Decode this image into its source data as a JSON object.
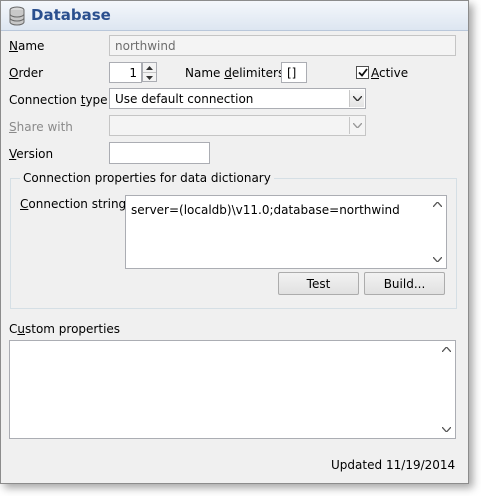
{
  "window": {
    "title": "Database",
    "title_icon": "database-icon"
  },
  "fields": {
    "name_label": "Name",
    "name_value": "northwind",
    "order_label": "Order",
    "order_value": "1",
    "name_delimiters_label": "Name delimiters",
    "name_delimiters_value": "[]",
    "active_label": "Active",
    "active_checked": true,
    "connection_type_label": "Connection type",
    "connection_type_value": "Use default connection",
    "share_with_label": "Share with",
    "share_with_value": "",
    "version_label": "Version",
    "version_value": ""
  },
  "connection_group": {
    "title": "Connection properties for data dictionary",
    "connection_string_label": "Connection string",
    "connection_string_value": "server=(localdb)\\v11.0;database=northwind",
    "test_button": "Test",
    "build_button": "Build..."
  },
  "custom_properties": {
    "label": "Custom properties",
    "value": ""
  },
  "footer": {
    "updated_label": "Updated",
    "updated_date": "11/19/2014"
  },
  "colors": {
    "title_text": "#2a4f8e",
    "accent_underline": "#000000"
  }
}
